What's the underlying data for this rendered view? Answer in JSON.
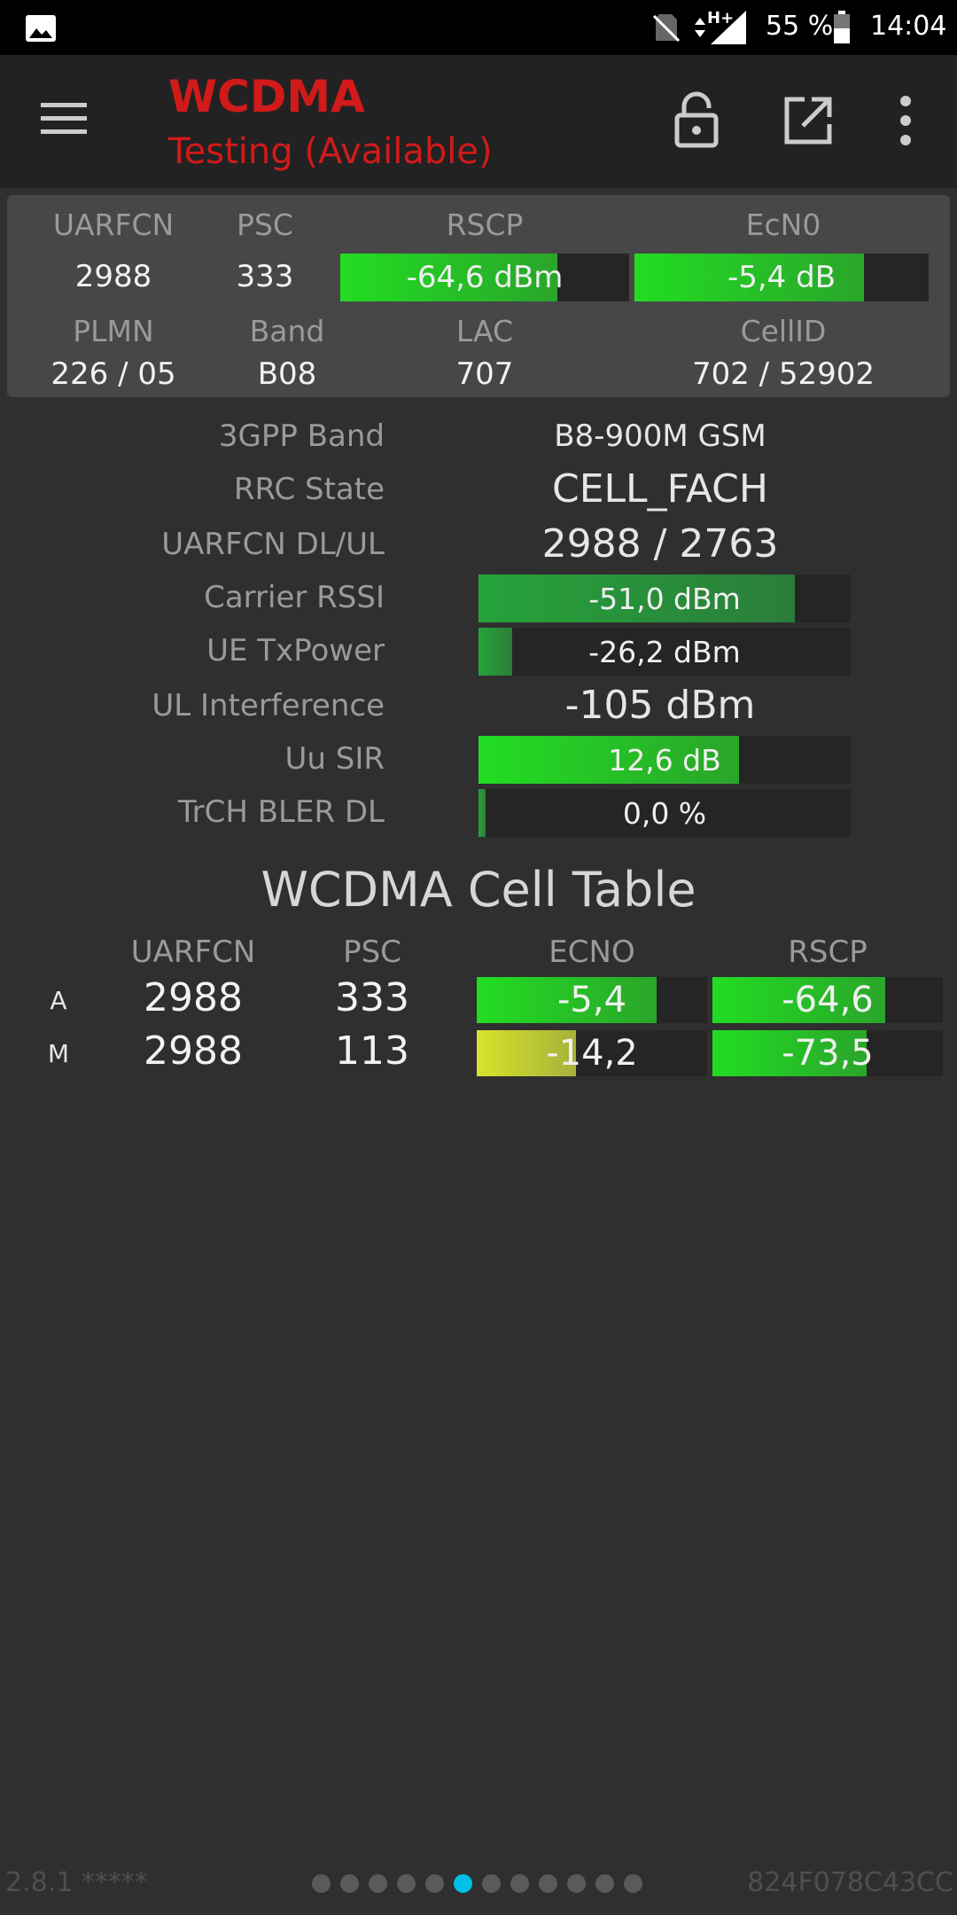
{
  "status_bar": {
    "battery": "55 %",
    "time": "14:04",
    "network_type": "H+"
  },
  "app_bar": {
    "title": "WCDMA",
    "subtitle": "Testing (Available)"
  },
  "summary": {
    "headers": {
      "uarfcn": "UARFCN",
      "psc": "PSC",
      "rscp": "RSCP",
      "ecn0": "EcN0",
      "plmn": "PLMN",
      "band": "Band",
      "lac": "LAC",
      "cellid": "CellID"
    },
    "values": {
      "uarfcn": "2988",
      "psc": "333",
      "rscp": "-64,6 dBm",
      "rscp_level": 0.75,
      "ecn0": "-5,4 dB",
      "ecn0_level": 0.78,
      "plmn": "226 / 05",
      "band": "B08",
      "lac": "707",
      "cellid": "702 / 52902"
    }
  },
  "params": [
    {
      "label": "3GPP Band",
      "value": "B8-900M GSM"
    },
    {
      "label": "RRC State",
      "value": "CELL_FACH"
    },
    {
      "label": "UARFCN DL/UL",
      "value": "2988 / 2763"
    },
    {
      "label": "Carrier RSSI",
      "value": "-51,0 dBm",
      "level": 0.85
    },
    {
      "label": "UE TxPower",
      "value": "-26,2 dBm",
      "level": 0.09
    },
    {
      "label": "UL Interference",
      "value": "-105 dBm"
    },
    {
      "label": "Uu SIR",
      "value": "12,6 dB",
      "level": 0.7
    },
    {
      "label": "TrCH BLER DL",
      "value": "0,0 %",
      "level": 0.02
    }
  ],
  "cell_table": {
    "title": "WCDMA Cell Table",
    "headers": {
      "uarfcn": "UARFCN",
      "psc": "PSC",
      "ecno": "ECNO",
      "rscp": "RSCP"
    },
    "rows": [
      {
        "type": "A",
        "uarfcn": "2988",
        "psc": "333",
        "ecno": "-5,4",
        "ecno_level": 0.78,
        "rscp": "-64,6",
        "rscp_level": 0.75
      },
      {
        "type": "M",
        "uarfcn": "2988",
        "psc": "113",
        "ecno": "-14,2",
        "ecno_level": 0.43,
        "rscp": "-73,5",
        "rscp_level": 0.67
      }
    ]
  },
  "footer": {
    "version": "2.8.1 *****",
    "device_id": "824F078C43CC",
    "page_count": 12,
    "active_page": 6
  },
  "colors": {
    "accent_red": "#d11a1a",
    "bar_green": "#22dd22",
    "bar_dark_green": "#2b7d3a",
    "bar_yellow": "#d8e22c",
    "active_dot": "#00bfe8"
  },
  "icons": [
    "image-icon",
    "no-sim-icon",
    "signal-icon",
    "battery-icon",
    "menu-icon",
    "lock-icon",
    "open-external-icon",
    "more-vert-icon"
  ]
}
